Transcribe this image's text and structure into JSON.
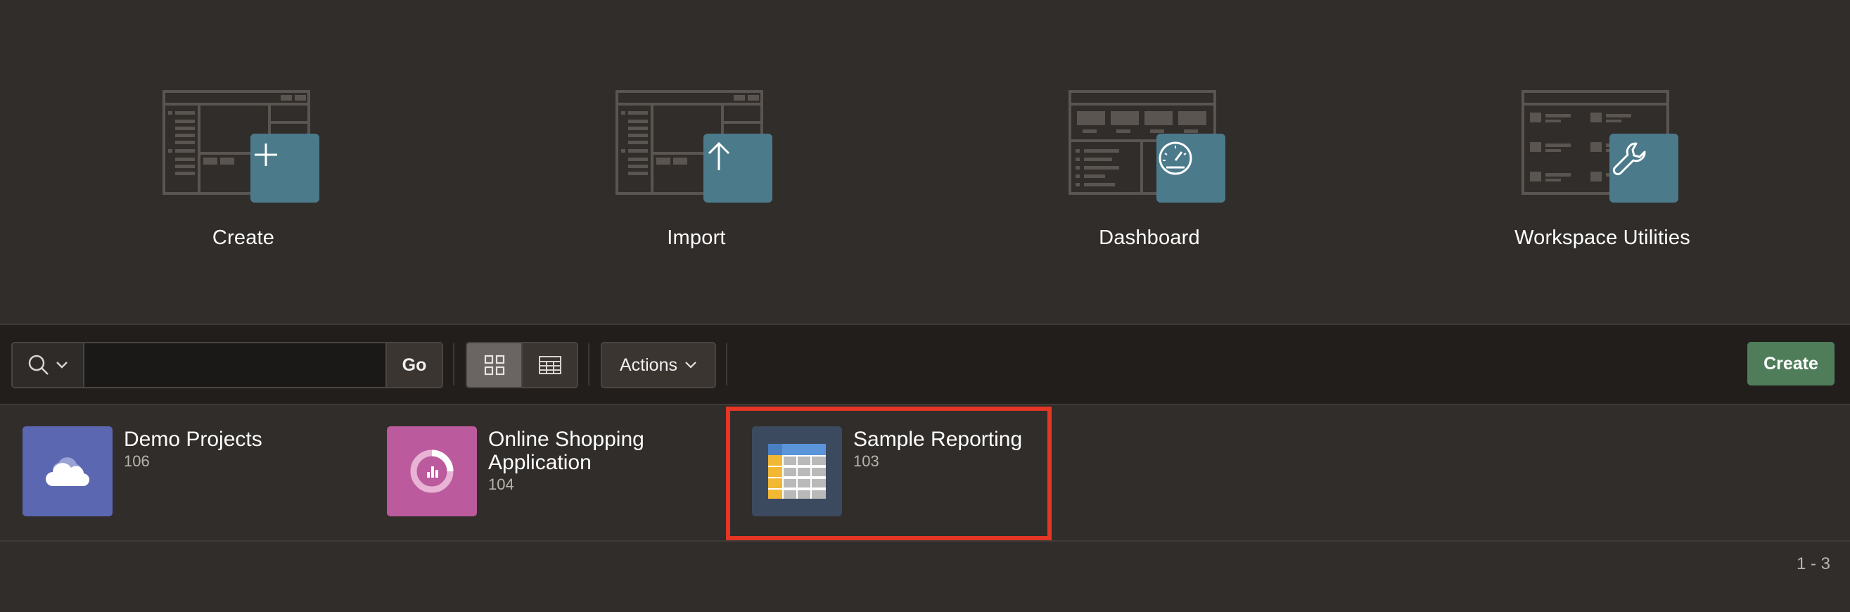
{
  "hero": {
    "cards": [
      {
        "label": "Create",
        "icon": "plus-icon"
      },
      {
        "label": "Import",
        "icon": "upload-arrow-icon"
      },
      {
        "label": "Dashboard",
        "icon": "speedometer-icon"
      },
      {
        "label": "Workspace Utilities",
        "icon": "wrench-icon"
      }
    ]
  },
  "toolbar": {
    "search_value": "",
    "go_label": "Go",
    "actions_label": "Actions",
    "create_label": "Create",
    "view_mode": "icons"
  },
  "apps": [
    {
      "name": "Demo Projects",
      "id": "106",
      "icon": "cloud-icon",
      "color": "#5b67b0"
    },
    {
      "name": "Online Shopping Application",
      "name_line1": "Online Shopping",
      "name_line2": "Application",
      "id": "104",
      "icon": "donut-chart-icon",
      "color": "#bb5a9d"
    },
    {
      "name": "Sample Reporting",
      "id": "103",
      "icon": "spreadsheet-icon",
      "color": "#3c4a60"
    }
  ],
  "pagination": "1 - 3",
  "colors": {
    "background": "#312d2a",
    "toolbar": "#211e1c",
    "accent_badge": "#4b7a8b",
    "create_button": "#4f7d5a",
    "highlight": "#e53524"
  }
}
